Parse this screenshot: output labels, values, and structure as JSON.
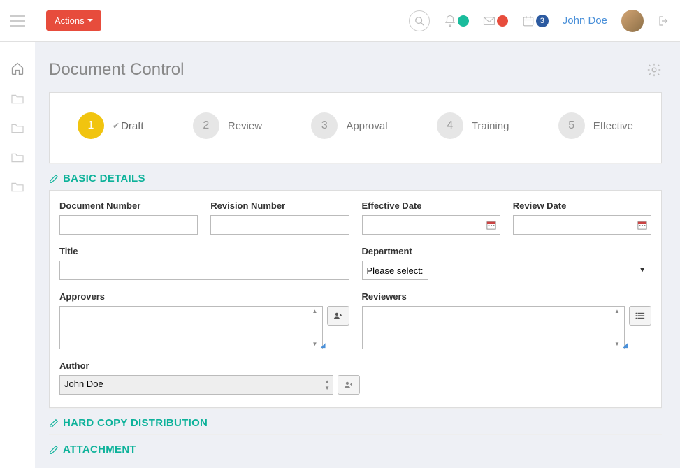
{
  "topbar": {
    "actions_label": "Actions",
    "calendar_badge": "3",
    "username": "John Doe"
  },
  "page": {
    "title": "Document Control"
  },
  "wizard": [
    {
      "num": "1",
      "label": "Draft",
      "current": true
    },
    {
      "num": "2",
      "label": "Review",
      "current": false
    },
    {
      "num": "3",
      "label": "Approval",
      "current": false
    },
    {
      "num": "4",
      "label": "Training",
      "current": false
    },
    {
      "num": "5",
      "label": "Effective",
      "current": false
    }
  ],
  "sections": {
    "basic": "Basic Details",
    "hardcopy": "Hard Copy Distribution",
    "attachment": "Attachment"
  },
  "form": {
    "doc_number_label": "Document Number",
    "doc_number": "",
    "rev_number_label": "Revision Number",
    "rev_number": "",
    "effective_label": "Effective Date",
    "effective": "",
    "review_date_label": "Review Date",
    "review_date": "",
    "title_label": "Title",
    "title": "",
    "dept_label": "Department",
    "dept_placeholder": "Please select:",
    "approvers_label": "Approvers",
    "reviewers_label": "Reviewers",
    "author_label": "Author",
    "author": "John Doe"
  }
}
